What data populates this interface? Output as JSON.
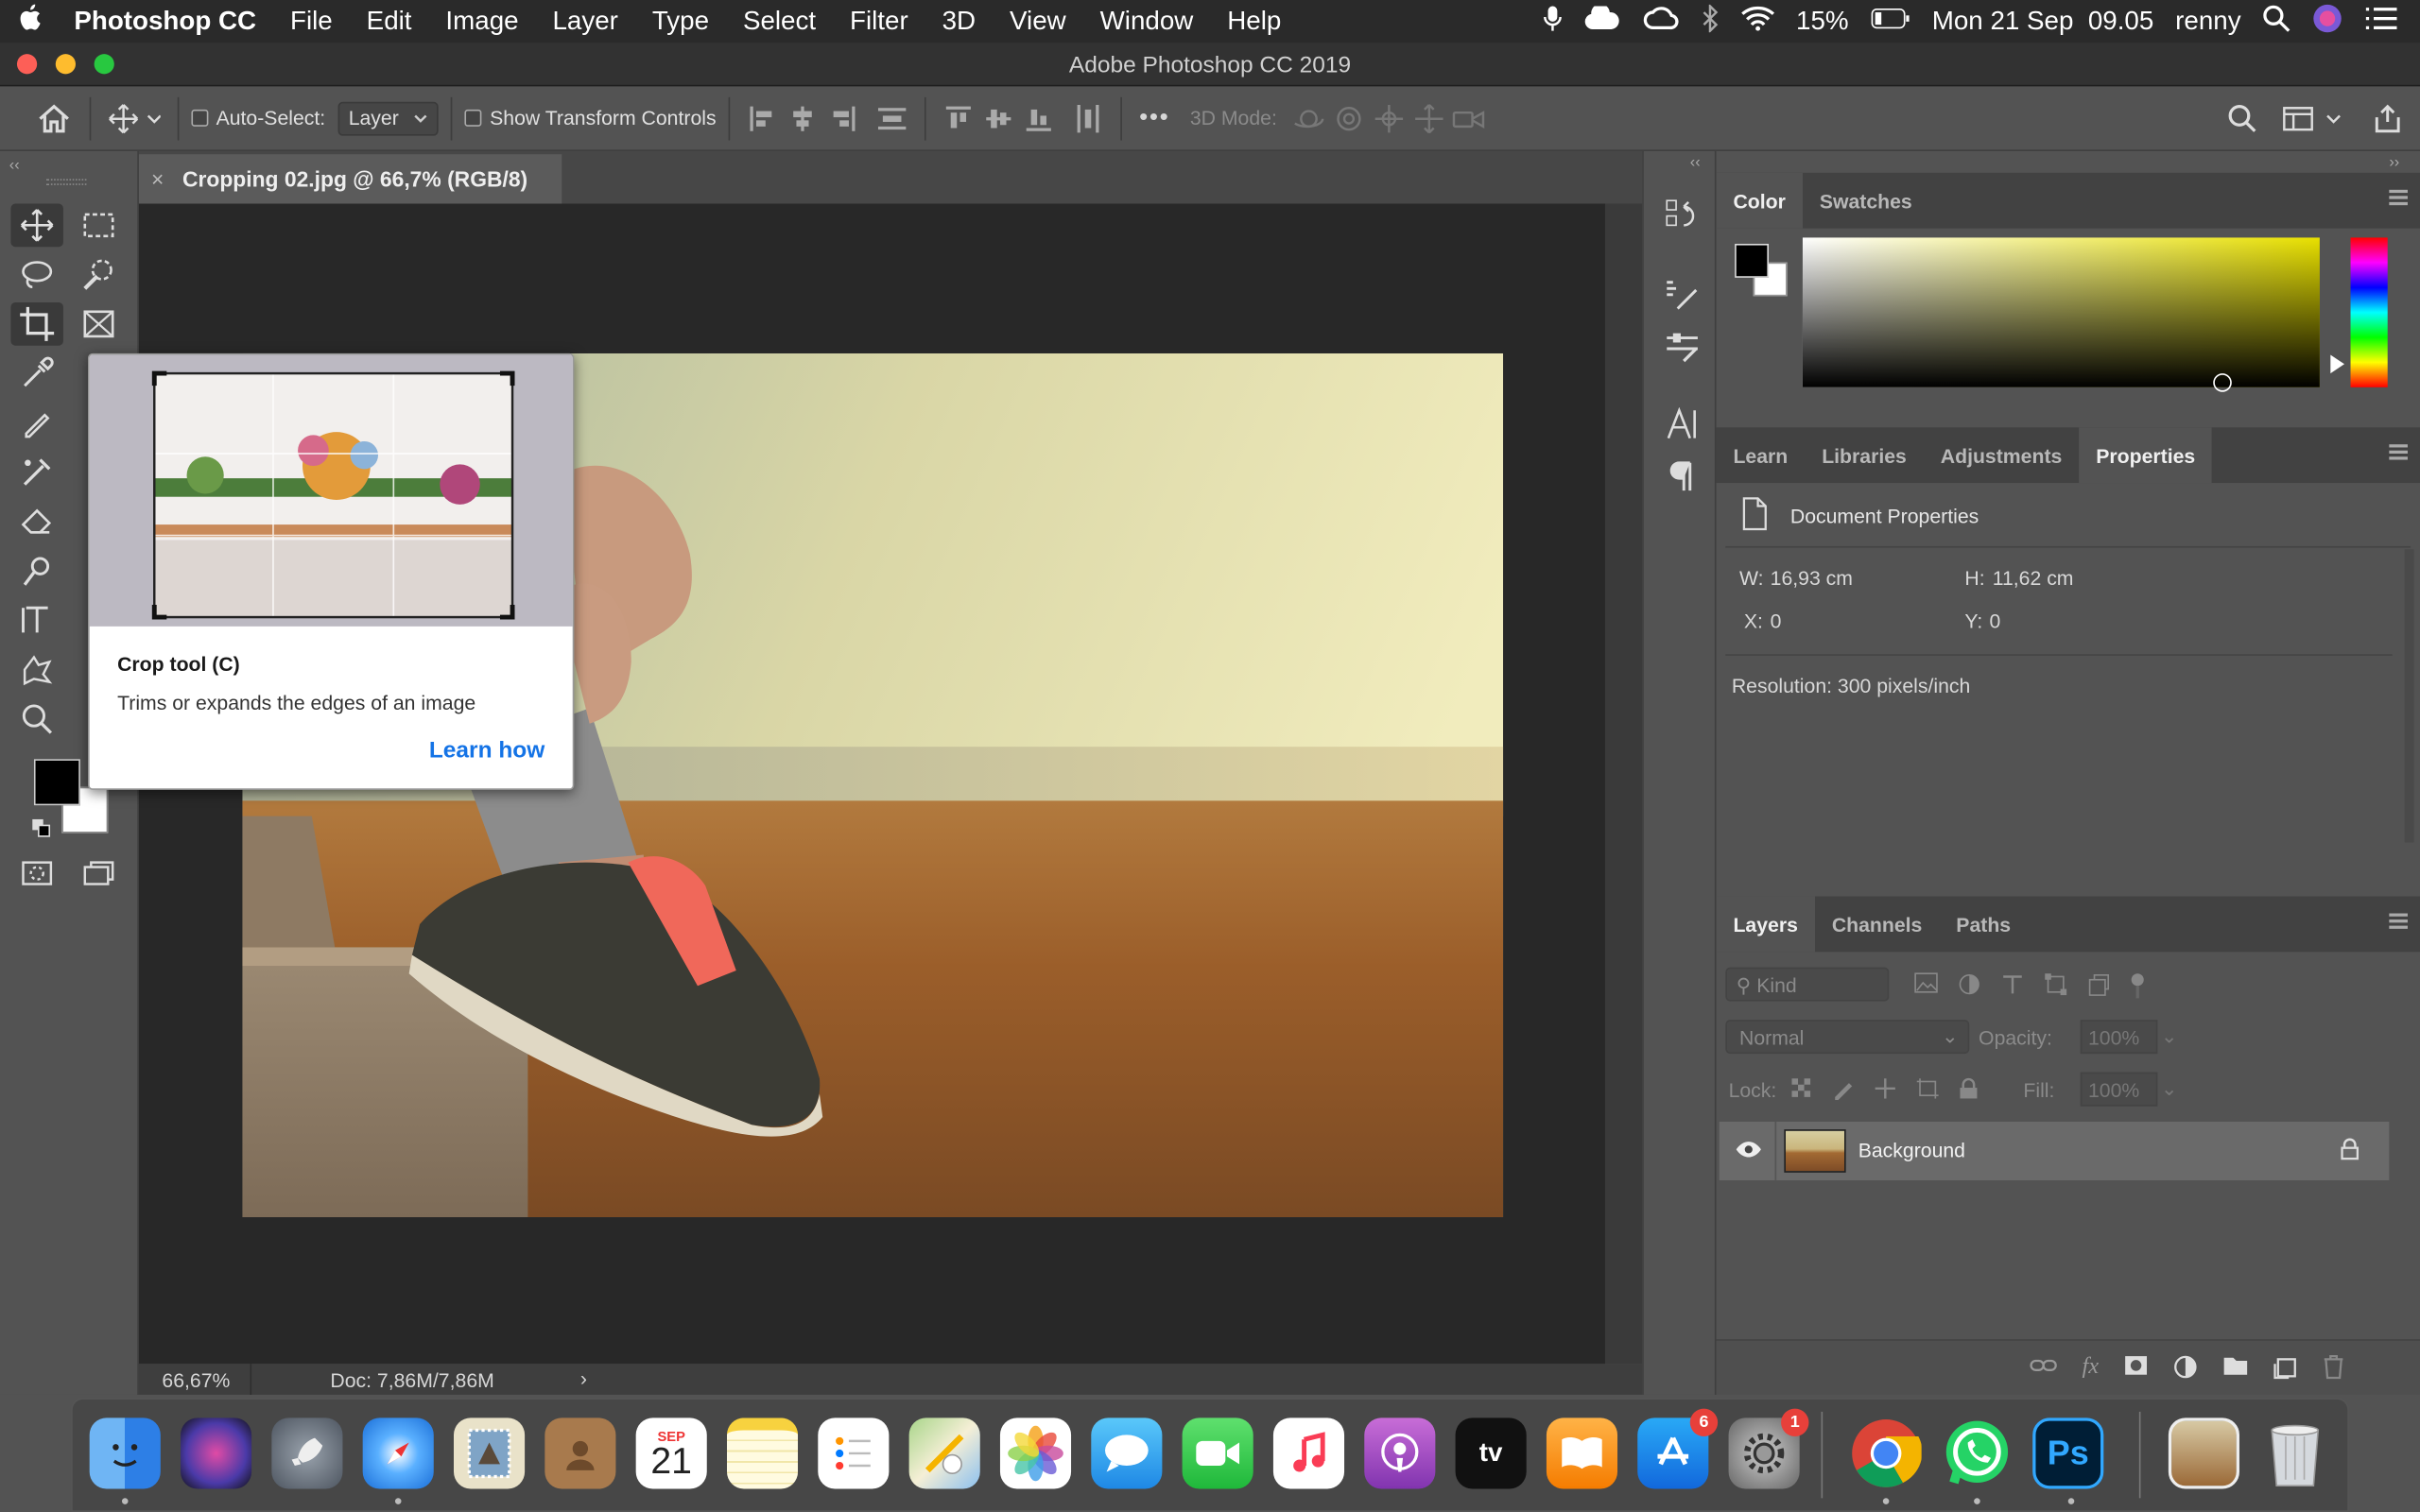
{
  "menubar": {
    "apple": "",
    "app_name": "Photoshop CC",
    "items": [
      "File",
      "Edit",
      "Image",
      "Layer",
      "Type",
      "Select",
      "Filter",
      "3D",
      "View",
      "Window",
      "Help"
    ],
    "battery": "15%",
    "datetime": "Mon 21 Sep  09.05",
    "user": "renny"
  },
  "window": {
    "title": "Adobe Photoshop CC 2019"
  },
  "options": {
    "auto_select_label": "Auto-Select:",
    "auto_select_value": "Layer",
    "show_transform_label": "Show Transform Controls",
    "more": "•••",
    "mode_3d_label": "3D Mode:"
  },
  "document": {
    "tab_title": "Cropping 02.jpg @ 66,7% (RGB/8)",
    "close": "×",
    "zoom": "66,67%",
    "doc_size": "Doc: 7,86M/7,86M",
    "status_arrow": "›"
  },
  "tooltip": {
    "title": "Crop tool (C)",
    "description": "Trims or expands the edges of an image",
    "link": "Learn how"
  },
  "color_panel": {
    "tabs": [
      "Color",
      "Swatches"
    ],
    "active": "Color",
    "foreground": "#000000",
    "background": "#ffffff"
  },
  "properties_panel": {
    "tabs": [
      "Learn",
      "Libraries",
      "Adjustments",
      "Properties"
    ],
    "active": "Properties",
    "heading": "Document Properties",
    "w_label": "W:",
    "w": "16,93 cm",
    "h_label": "H:",
    "h": "11,62 cm",
    "x_label": "X:",
    "x": "0",
    "y_label": "Y:",
    "y": "0",
    "resolution": "Resolution: 300 pixels/inch"
  },
  "layers_panel": {
    "tabs": [
      "Layers",
      "Channels",
      "Paths"
    ],
    "active": "Layers",
    "kind_placeholder": "Kind",
    "blend_mode": "Normal",
    "opacity_label": "Opacity:",
    "opacity": "100%",
    "lock_label": "Lock:",
    "fill_label": "Fill:",
    "fill": "100%",
    "layers": [
      {
        "name": "Background",
        "visible": true,
        "locked": true
      }
    ]
  },
  "dock": {
    "calendar_month": "SEP",
    "calendar_day": "21",
    "appstore_badge": "6",
    "settings_badge": "1",
    "tv_label": "tv",
    "ps_label": "Ps"
  }
}
